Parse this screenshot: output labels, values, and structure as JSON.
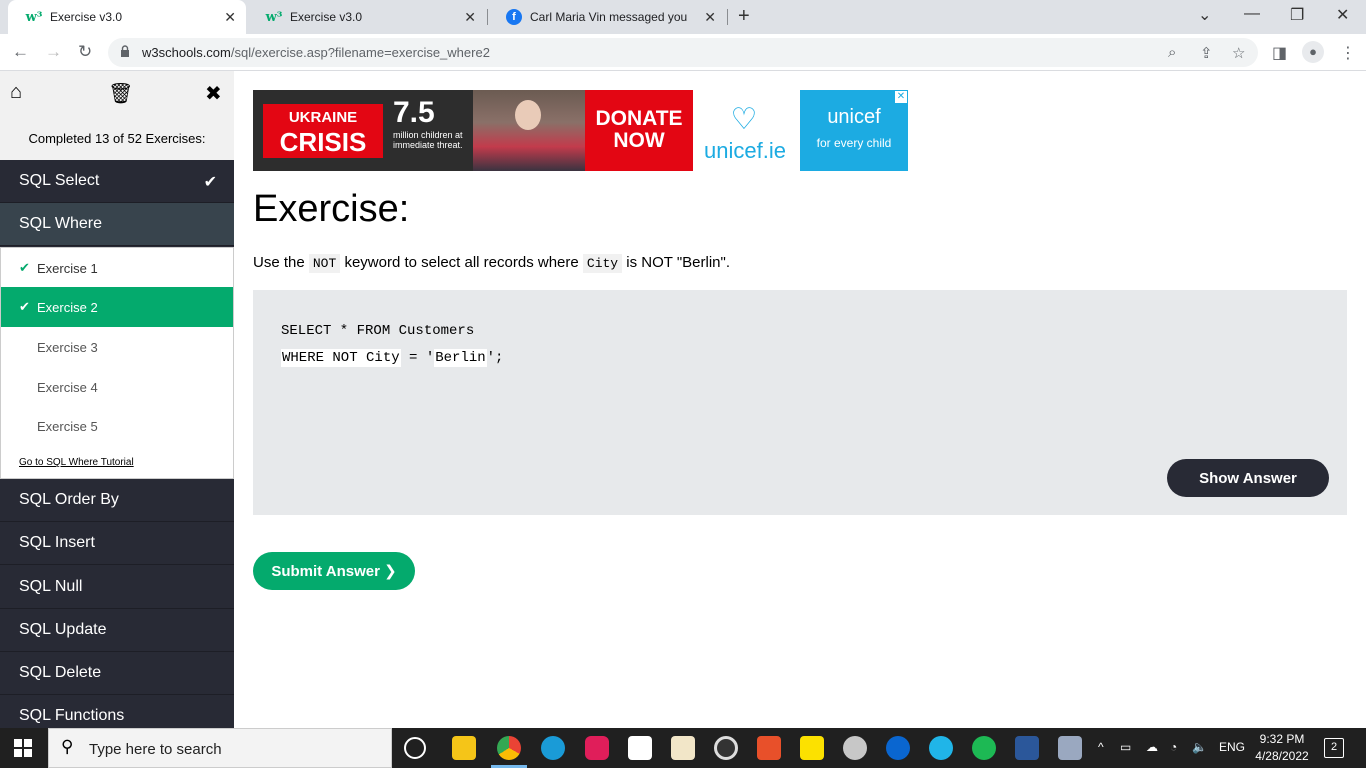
{
  "browser": {
    "tabs": [
      {
        "title": "Exercise v3.0",
        "icon": "w3schools-icon",
        "active": true
      },
      {
        "title": "Exercise v3.0",
        "icon": "w3schools-icon",
        "active": false
      },
      {
        "title": "Carl Maria Vin messaged you",
        "icon": "facebook-icon",
        "active": false
      }
    ],
    "url_host": "w3schools.com",
    "url_path": "/sql/exercise.asp?filename=exercise_where2"
  },
  "sidebar": {
    "completed_text": "Completed 13 of 52 Exercises:",
    "sections_top": [
      {
        "label": "SQL Select",
        "done": true
      },
      {
        "label": "SQL Where",
        "done": false
      }
    ],
    "exercises": [
      {
        "label": "Exercise 1",
        "done": true,
        "active": false
      },
      {
        "label": "Exercise 2",
        "done": true,
        "active": true
      },
      {
        "label": "Exercise 3",
        "done": false,
        "active": false
      },
      {
        "label": "Exercise 4",
        "done": false,
        "active": false
      },
      {
        "label": "Exercise 5",
        "done": false,
        "active": false
      }
    ],
    "tutorial_link": "Go to SQL Where Tutorial",
    "sections_bottom": [
      {
        "label": "SQL Order By"
      },
      {
        "label": "SQL Insert"
      },
      {
        "label": "SQL Null"
      },
      {
        "label": "SQL Update"
      },
      {
        "label": "SQL Delete"
      },
      {
        "label": "SQL Functions"
      }
    ]
  },
  "ad": {
    "ukraine": "UKRAINE",
    "crisis": "CRISIS",
    "number": "7.5",
    "children_text": "million children at immediate threat.",
    "donate": "DONATE NOW",
    "unicef_ie": "unicef.ie",
    "unicef": "unicef",
    "for_every_child": "for every child"
  },
  "exercise": {
    "title": "Exercise:",
    "desc_before": "Use the ",
    "kw1": "NOT",
    "desc_mid": " keyword to select all records where ",
    "kw2": "City",
    "desc_after": " is NOT \"Berlin\".",
    "code_line1": "SELECT * FROM Customers",
    "code_line2_input1": "WHERE NOT City",
    "code_line2_mid": " = '",
    "code_line2_input2": "Berlin",
    "code_line2_end": "';",
    "show_answer": "Show Answer",
    "submit": "Submit Answer ❯"
  },
  "taskbar": {
    "search_placeholder": "Type here to search",
    "lang": "ENG",
    "time": "9:32 PM",
    "date": "4/28/2022",
    "notifications": "2"
  },
  "colors": {
    "accent": "#04AA6D",
    "sidebar_dark": "#282a35",
    "sidebar_mid": "#38444d",
    "code_bg": "#e7e9eb"
  }
}
